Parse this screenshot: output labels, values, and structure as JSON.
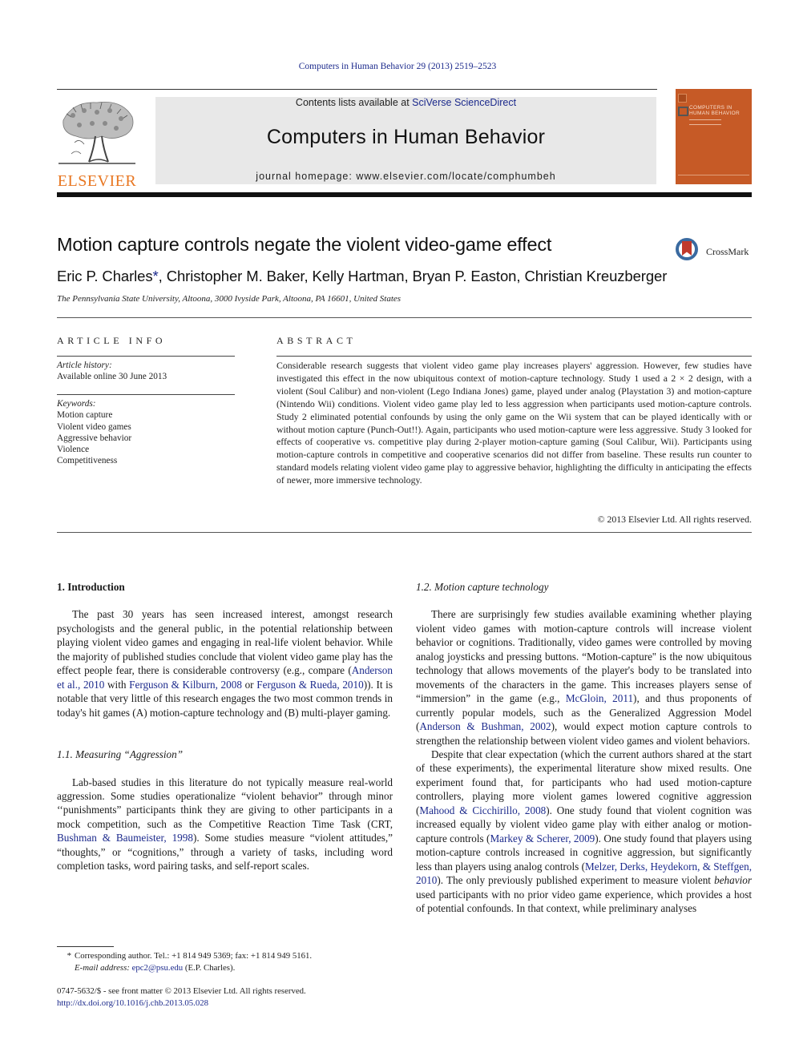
{
  "running_head": "Computers in Human Behavior 29 (2013) 2519–2523",
  "masthead": {
    "publisher_logo": "ELSEVIER",
    "contents_prefix": "Contents lists available at ",
    "contents_link": "SciVerse ScienceDirect",
    "journal_title": "Computers in Human Behavior",
    "homepage": "journal homepage: www.elsevier.com/locate/comphumbeh",
    "cover_title_line1": "COMPUTERS IN",
    "cover_title_line2": "HUMAN BEHAVIOR",
    "colors": {
      "cover": "#c65a26",
      "elsevier_orange": "#e87722",
      "link_blue": "#1c2a8c",
      "banner_gray": "#e8e8e8"
    }
  },
  "article": {
    "title": "Motion capture controls negate the violent video-game effect",
    "crossmark_label": "CrossMark",
    "authors": [
      {
        "name": "Eric P. Charles",
        "mark": "*"
      },
      {
        "name": "Christopher M. Baker"
      },
      {
        "name": "Kelly Hartman"
      },
      {
        "name": "Bryan P. Easton"
      },
      {
        "name": "Christian Kreuzberger"
      }
    ],
    "author_sep": ", ",
    "affiliation": "The Pennsylvania State University, Altoona, 3000 Ivyside Park, Altoona, PA 16601, United States"
  },
  "article_info": {
    "heading": "ARTICLE INFO",
    "history_label": "Article history:",
    "history_value": "Available online 30 June 2013",
    "keywords_label": "Keywords:",
    "keywords": [
      "Motion capture",
      "Violent video games",
      "Aggressive behavior",
      "Violence",
      "Competitiveness"
    ]
  },
  "abstract": {
    "heading": "ABSTRACT",
    "text": "Considerable research suggests that violent video game play increases players' aggression. However, few studies have investigated this effect in the now ubiquitous context of motion-capture technology. Study 1 used a 2 × 2 design, with a violent (Soul Calibur) and non-violent (Lego Indiana Jones) game, played under analog (Playstation 3) and motion-capture (Nintendo Wii) conditions. Violent video game play led to less aggression when participants used motion-capture controls. Study 2 eliminated potential confounds by using the only game on the Wii system that can be played identically with or without motion capture (Punch-Out!!). Again, participants who used motion-capture were less aggressive. Study 3 looked for effects of cooperative vs. competitive play during 2-player motion-capture gaming (Soul Calibur, Wii). Participants using motion-capture controls in competitive and cooperative scenarios did not differ from baseline. These results run counter to standard models relating violent video game play to aggressive behavior, highlighting the difficulty in anticipating the effects of newer, more immersive technology.",
    "copyright": "© 2013 Elsevier Ltd. All rights reserved."
  },
  "body": {
    "intro": {
      "heading": "1. Introduction",
      "p1_a": "The past 30 years has seen increased interest, amongst research psychologists and the general public, in the potential relationship between playing violent video games and engaging in real-life violent behavior. While the majority of published studies conclude that violent video game play has the effect people fear, there is considerable controversy (e.g., compare (",
      "p1_ref1": "Anderson et al., 2010",
      "p1_b": " with ",
      "p1_ref2": "Ferguson & Kilburn, 2008",
      "p1_c": " or ",
      "p1_ref3": "Ferguson & Rueda, 2010",
      "p1_d": ")). It is notable that very little of this research engages the two most common trends in today's hit games (A) motion-capture technology and (B) multi-player gaming."
    },
    "s11": {
      "heading": "1.1. Measuring “Aggression”",
      "p_a": "Lab-based studies in this literature do not typically measure real-world aggression. Some studies operationalize “violent behavior” through minor ‘‘punishments” participants think they are giving to other participants in a mock competition, such as the Competitive Reaction Time Task (CRT, ",
      "p_ref1": "Bushman & Baumeister, 1998",
      "p_b": "). Some studies measure “violent attitudes,” “thoughts,” or “cognitions,” through a variety of tasks, including word completion tasks, word pairing tasks, and self-report scales."
    },
    "s12": {
      "heading": "1.2. Motion capture technology",
      "p1_a": "There are surprisingly few studies available examining whether playing violent video games with motion-capture controls will increase violent behavior or cognitions. Traditionally, video games were controlled by moving analog joysticks and pressing buttons. “Motion-capture'' is the now ubiquitous technology that allows movements of the player's body to be translated into movements of the characters in the game. This increases players sense of “immersion” in the game (e.g., ",
      "p1_ref1": "McGloin, 2011",
      "p1_b": "), and thus proponents of currently popular models, such as the Generalized Aggression Model (",
      "p1_ref2": "Anderson & Bushman, 2002",
      "p1_c": "), would expect motion capture controls to strengthen the relationship between violent video games and violent behaviors.",
      "p2_a": "Despite that clear expectation (which the current authors shared at the start of these experiments), the experimental literature show mixed results. One experiment found that, for participants who had used motion-capture controllers, playing more violent games lowered cognitive aggression (",
      "p2_ref1": "Mahood & Cicchirillo, 2008",
      "p2_b": "). One study found that violent cognition was increased equally by violent video game play with either analog or motion-capture controls (",
      "p2_ref2": "Markey & Scherer, 2009",
      "p2_c": "). One study found that players using motion-capture controls increased in cognitive aggression, but significantly less than players using analog controls (",
      "p2_ref3": "Melzer, Derks, Heydekorn, & Steffgen, 2010",
      "p2_d": "). The only previously published experiment to measure violent ",
      "p2_em": "behavior",
      "p2_e": " used participants with no prior video game experience, which provides a host of potential confounds. In that context, while preliminary analyses"
    }
  },
  "footnote": {
    "star": "*",
    "corresponding": "Corresponding author. Tel.: +1 814 949 5369; fax: +1 814 949 5161.",
    "email_label": "E-mail address:",
    "email": "epc2@psu.edu",
    "email_suffix": " (E.P. Charles)."
  },
  "front_matter": {
    "issn_line": "0747-5632/$ - see front matter © 2013 Elsevier Ltd. All rights reserved.",
    "doi": "http://dx.doi.org/10.1016/j.chb.2013.05.028"
  }
}
